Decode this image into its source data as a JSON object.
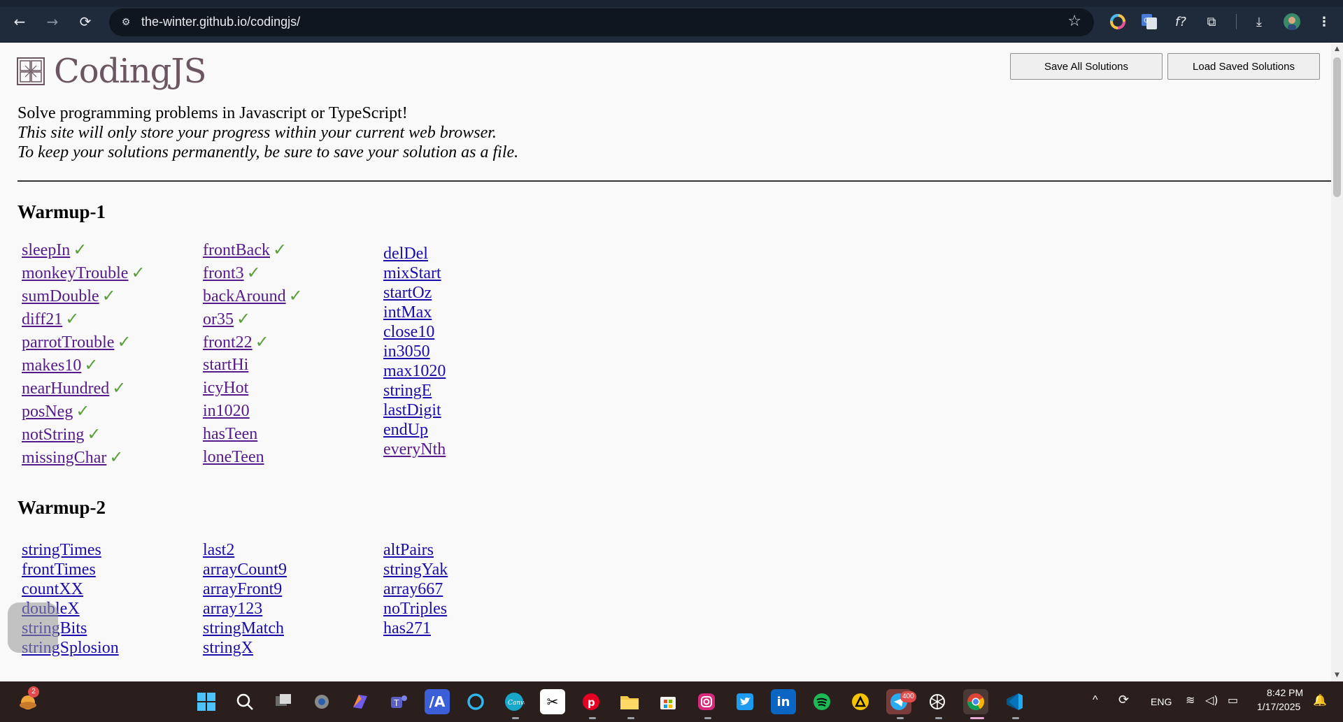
{
  "browser": {
    "url": "the-winter.github.io/codingjs/",
    "back_icon": "←",
    "forward_icon": "→",
    "reload_icon": "⟳",
    "site_settings_icon": "⚙",
    "bookmark_icon": "☆",
    "extension_icons": [
      "◉",
      "G",
      "f?",
      "⧉",
      "⤓",
      "●",
      "⋮"
    ]
  },
  "page": {
    "title": "CodingJS",
    "save_all_label": "Save All Solutions",
    "load_saved_label": "Load Saved Solutions",
    "intro_line1": "Solve programming problems in Javascript or TypeScript!",
    "intro_line2": "This site will only store your progress within your current web browser.",
    "intro_line3": "To keep your solutions permanently, be sure to save your solution as a file.",
    "check_mark": "✓",
    "colors": {
      "title": "#6b5560",
      "check": "#5a9e3a",
      "link": "#1a0dab",
      "visited": "#551a8b"
    }
  },
  "sections": [
    {
      "title": "Warmup-1",
      "columns": [
        {
          "items": [
            {
              "label": "sleepIn",
              "done": true
            },
            {
              "label": "monkeyTrouble",
              "done": true
            },
            {
              "label": "sumDouble",
              "done": true
            },
            {
              "label": "diff21",
              "done": true
            },
            {
              "label": "parrotTrouble",
              "done": true
            },
            {
              "label": "makes10",
              "done": true
            },
            {
              "label": "nearHundred",
              "done": true
            },
            {
              "label": "posNeg",
              "done": true
            },
            {
              "label": "notString",
              "done": true
            },
            {
              "label": "missingChar",
              "done": true
            }
          ]
        },
        {
          "items": [
            {
              "label": "frontBack",
              "done": true
            },
            {
              "label": "front3",
              "done": true
            },
            {
              "label": "backAround",
              "done": true
            },
            {
              "label": "or35",
              "done": true
            },
            {
              "label": "front22",
              "done": true
            },
            {
              "label": "startHi",
              "done": false
            },
            {
              "label": "icyHot",
              "done": false
            },
            {
              "label": "in1020",
              "done": false
            },
            {
              "label": "hasTeen",
              "done": false
            },
            {
              "label": "loneTeen",
              "done": false
            }
          ]
        },
        {
          "items": [
            {
              "label": "delDel",
              "done": false
            },
            {
              "label": "mixStart",
              "done": false
            },
            {
              "label": "startOz",
              "done": false
            },
            {
              "label": "intMax",
              "done": false
            },
            {
              "label": "close10",
              "done": false
            },
            {
              "label": "in3050",
              "done": false
            },
            {
              "label": "max1020",
              "done": false
            },
            {
              "label": "stringE",
              "done": false
            },
            {
              "label": "lastDigit",
              "done": false
            },
            {
              "label": "endUp",
              "done": false
            },
            {
              "label": "everyNth",
              "done": false,
              "visited": true
            }
          ]
        }
      ]
    },
    {
      "title": "Warmup-2",
      "columns": [
        {
          "items": [
            {
              "label": "stringTimes",
              "done": false
            },
            {
              "label": "frontTimes",
              "done": false
            },
            {
              "label": "countXX",
              "done": false
            },
            {
              "label": "doubleX",
              "done": false
            },
            {
              "label": "stringBits",
              "done": false
            },
            {
              "label": "stringSplosion",
              "done": false
            }
          ]
        },
        {
          "items": [
            {
              "label": "last2",
              "done": false
            },
            {
              "label": "arrayCount9",
              "done": false
            },
            {
              "label": "arrayFront9",
              "done": false
            },
            {
              "label": "array123",
              "done": false
            },
            {
              "label": "stringMatch",
              "done": false
            },
            {
              "label": "stringX",
              "done": false
            }
          ]
        },
        {
          "items": [
            {
              "label": "altPairs",
              "done": false
            },
            {
              "label": "stringYak",
              "done": false
            },
            {
              "label": "array667",
              "done": false
            },
            {
              "label": "noTriples",
              "done": false
            },
            {
              "label": "has271",
              "done": false
            }
          ]
        }
      ]
    }
  ],
  "taskbar": {
    "weather_badge": "2",
    "telegram_badge": "400",
    "language": "ENG",
    "time": "8:42 PM",
    "date": "1/17/2025",
    "apps": [
      "windows-start",
      "search",
      "task-view",
      "settings",
      "copilot",
      "teams",
      "app-a",
      "cortana",
      "canva",
      "capcut",
      "pinterest",
      "file-explorer",
      "store",
      "instagram",
      "twitter",
      "linkedin",
      "spotify",
      "app-b",
      "telegram",
      "chatgpt",
      "chrome",
      "vscode"
    ]
  }
}
